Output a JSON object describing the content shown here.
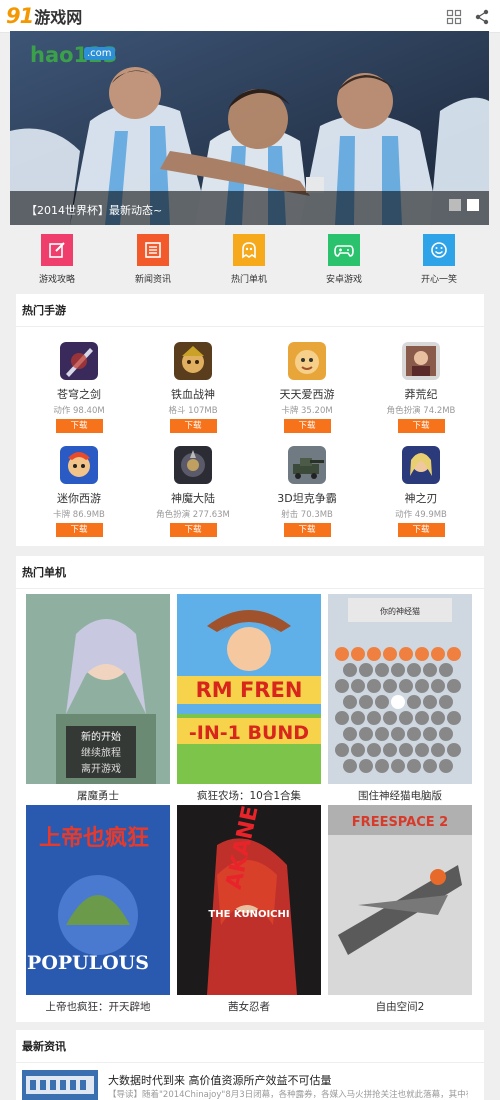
{
  "header": {
    "logo_number": "91",
    "logo_text": "游戏网",
    "grid_icon": "grid-icon",
    "share_icon": "share-icon"
  },
  "banner": {
    "caption": "【2014世界杯】最新动态~",
    "logo_text": "hao123",
    "logo_badge": ".com",
    "slide_count": 2,
    "active_slide": 2
  },
  "nav": {
    "items": [
      {
        "label": "游戏攻略",
        "icon": "edit-icon",
        "color": "#ef3e6b"
      },
      {
        "label": "新闻资讯",
        "icon": "news-icon",
        "color": "#f25a2c"
      },
      {
        "label": "热门单机",
        "icon": "ghost-icon",
        "color": "#f5a91b"
      },
      {
        "label": "安卓游戏",
        "icon": "gamepad-icon",
        "color": "#2bc26d"
      },
      {
        "label": "开心一笑",
        "icon": "smile-icon",
        "color": "#2ea3e8"
      }
    ]
  },
  "mobile_games": {
    "title": "热门手游",
    "download_label": "下载",
    "items": [
      {
        "name": "苍穹之剑",
        "meta": "动作 98.40M"
      },
      {
        "name": "铁血战神",
        "meta": "格斗 107MB"
      },
      {
        "name": "天天爱西游",
        "meta": "卡牌 35.20M"
      },
      {
        "name": "莽荒纪",
        "meta": "角色扮演 74.2MB"
      },
      {
        "name": "迷你西游",
        "meta": "卡牌 86.9MB"
      },
      {
        "name": "神魔大陆",
        "meta": "角色扮演 277.63M"
      },
      {
        "name": "3D坦克争霸",
        "meta": "射击 70.3MB"
      },
      {
        "name": "神之刃",
        "meta": "动作 49.9MB"
      }
    ]
  },
  "pc_games": {
    "title": "热门单机",
    "items": [
      {
        "title": "屠魔勇士",
        "cover_text": [
          "新的开始",
          "继续旅程",
          "离开游戏"
        ]
      },
      {
        "title": "疯狂农场：10合1合集",
        "cover_text": [
          "RM FREN",
          "-IN-1 BUND"
        ]
      },
      {
        "title": "围住神经猫电脑版",
        "cover_text": [
          "你的神经猫"
        ]
      },
      {
        "title": "上帝也疯狂：开天辟地",
        "cover_text": [
          "上帝也疯狂",
          "POPULOUS"
        ]
      },
      {
        "title": "茜女忍者",
        "cover_text": [
          "AKANE",
          "THE KUNOICHI"
        ]
      },
      {
        "title": "自由空间2",
        "cover_text": [
          "FREESPACE 2"
        ]
      }
    ]
  },
  "news": {
    "title": "最新资讯",
    "items": [
      {
        "title": "大数据时代到来 高价值资源所产效益不可估量",
        "summary": "【导读】随着\"2014Chinajoy\"8月3日闭幕，各种露券，各媒入马火拼抢关注也就此落幕，其中有..."
      }
    ]
  }
}
